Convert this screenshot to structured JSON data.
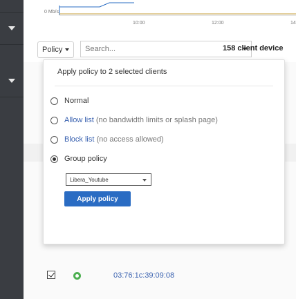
{
  "chart": {
    "y_label": "0 Mb/s",
    "x_ticks": [
      "10:00",
      "12:00",
      "14"
    ]
  },
  "filter": {
    "policy_label": "Policy",
    "search_placeholder": "Search...",
    "client_count": "158 client device"
  },
  "panel": {
    "title": "Apply policy to 2 selected clients",
    "options": [
      {
        "main": "Normal",
        "note": "",
        "checked": false
      },
      {
        "main": "Allow list",
        "note": " (no bandwidth limits or splash page)",
        "checked": false
      },
      {
        "main": "Block list",
        "note": " (no access allowed)",
        "checked": false
      },
      {
        "main": "Group policy",
        "note": "",
        "checked": true
      }
    ],
    "group_select": "Libera_Youtube",
    "apply_label": "Apply policy"
  },
  "row": {
    "mac": "03:76:1c:39:09:08"
  },
  "colors": {
    "accent": "#2a6cc3",
    "sidebar": "#3a3d42",
    "status_online": "#4caf50",
    "link": "#3a62b0"
  }
}
